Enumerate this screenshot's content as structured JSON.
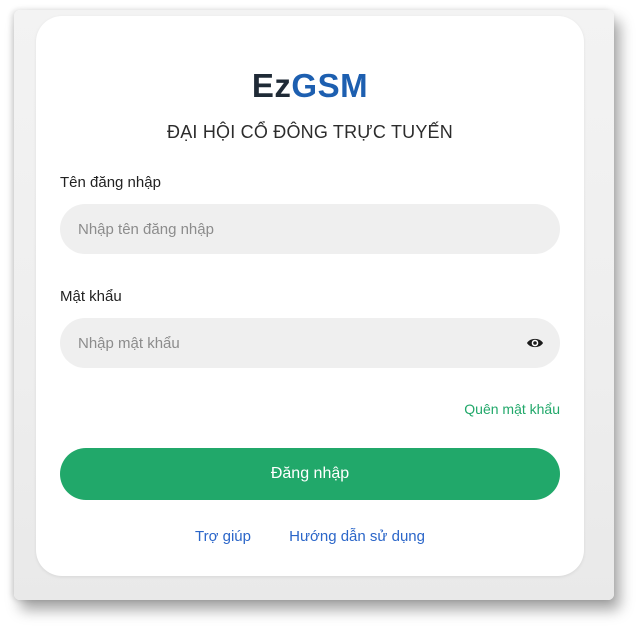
{
  "brand": {
    "part1": "Ez",
    "part2": "GSM",
    "part1_color": "#1f2a36",
    "part2_color": "#1d5fb0"
  },
  "subtitle": "ĐẠI HỘI CỔ ĐÔNG TRỰC TUYẾN",
  "form": {
    "username_label": "Tên đăng nhập",
    "username_placeholder": "Nhập tên đăng nhập",
    "username_value": "",
    "password_label": "Mật khẩu",
    "password_placeholder": "Nhập mật khẩu",
    "password_value": "",
    "show_password_icon": "eye-icon",
    "forgot_password": "Quên mật khẩu",
    "login_button": "Đăng nhập"
  },
  "footer_links": {
    "help": "Trợ giúp",
    "guide": "Hướng dẫn sử dụng"
  },
  "colors": {
    "primary_green": "#21a86a",
    "link_blue": "#2b66c9",
    "input_bg": "#efefef"
  }
}
